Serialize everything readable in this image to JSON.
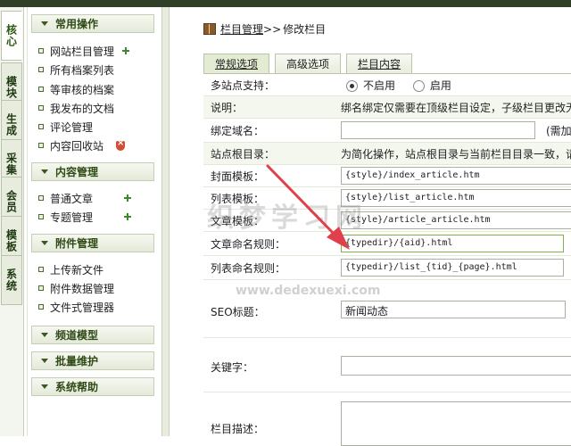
{
  "vtabs": [
    "核心",
    "模块",
    "生成",
    "采集",
    "会员",
    "模板",
    "系统"
  ],
  "menu": {
    "sections": [
      {
        "title": "常用操作",
        "items": [
          "网站栏目管理",
          "所有档案列表",
          "等审核的档案",
          "我发布的文档",
          "评论管理",
          "内容回收站"
        ]
      },
      {
        "title": "内容管理",
        "items": [
          "普通文章",
          "专题管理"
        ]
      },
      {
        "title": "附件管理",
        "items": [
          "上传新文件",
          "附件数据管理",
          "文件式管理器"
        ]
      },
      {
        "title": "频道模型",
        "items": []
      },
      {
        "title": "批量维护",
        "items": []
      },
      {
        "title": "系统帮助",
        "items": []
      }
    ]
  },
  "breadcrumb": {
    "link": "栏目管理",
    "sep": ">>",
    "current": "修改栏目"
  },
  "tabs": [
    "常规选项",
    "高级选项",
    "栏目内容"
  ],
  "form": {
    "multisite_label": "多站点支持：",
    "multisite_off": "不启用",
    "multisite_on": "启用",
    "note_label": "说明：",
    "note_text": "绑名绑定仅需要在顶级栏目设定，子级栏目更改无效",
    "binddomain_label": "绑定域名：",
    "binddomain_value": "",
    "binddomain_side": "(需加",
    "siteroot_label": "站点根目录：",
    "siteroot_text": "为简化操作，站点根目录与当前栏目目录一致，请注",
    "index_tpl_label": "封面模板：",
    "index_tpl_value": "{style}/index_article.htm",
    "list_tpl_label": "列表模板：",
    "list_tpl_value": "{style}/list_article.htm",
    "article_tpl_label": "文章模板：",
    "article_tpl_value": "{style}/article_article.htm",
    "article_rule_label": "文章命名规则：",
    "article_rule_value": "{typedir}/{aid}.html",
    "list_rule_label": "列表命名规则：",
    "list_rule_value": "{typedir}/list_{tid}_{page}.html",
    "seo_title_label": "SEO标题：",
    "seo_title_value": "新闻动态",
    "keywords_label": "关键字：",
    "keywords_value": "",
    "desc_label": "栏目描述：",
    "desc_value": ""
  },
  "watermark": {
    "main": "织梦学习网",
    "url": "www.dedexuexi.com"
  },
  "colors": {
    "accent": "#2c5a12",
    "arrow": "#e0404a",
    "topbar": "#2f3f28"
  }
}
